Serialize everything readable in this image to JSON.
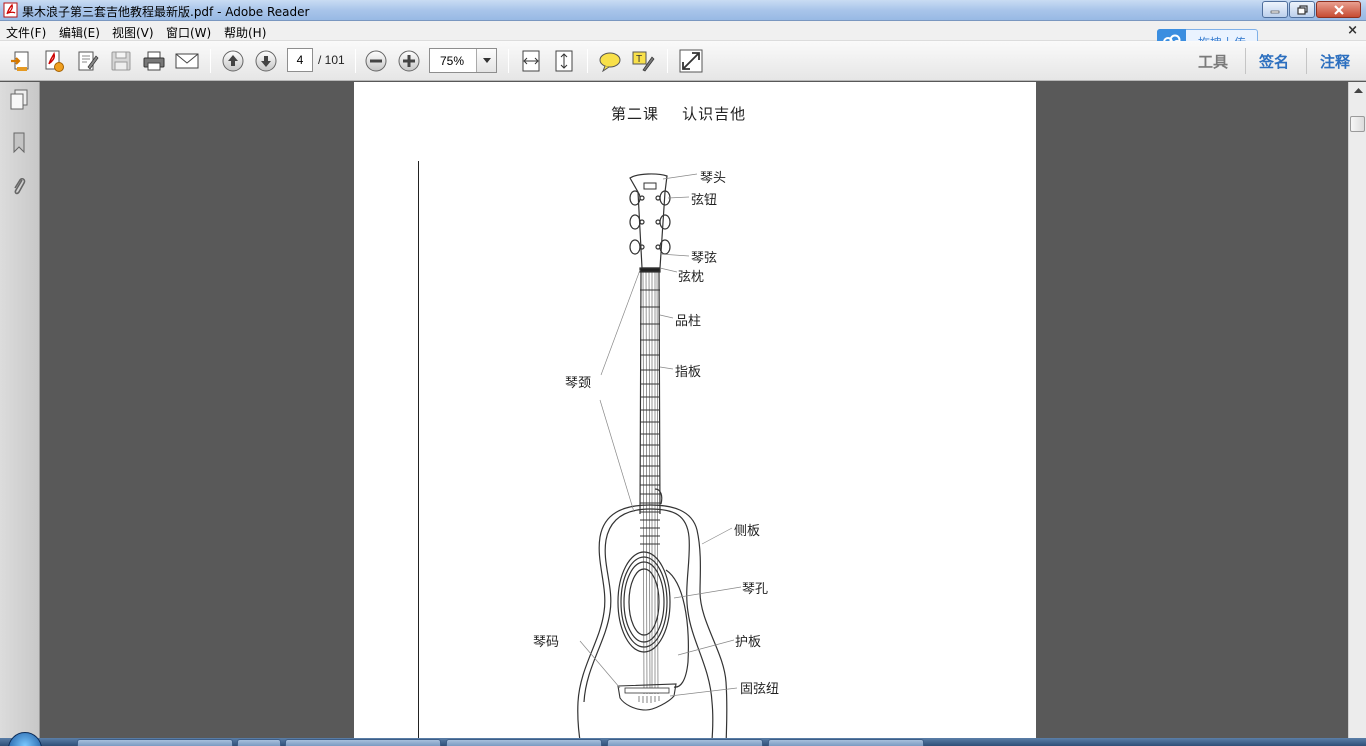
{
  "window": {
    "title": "果木浪子第三套吉他教程最新版.pdf - Adobe Reader"
  },
  "menu": {
    "items": [
      "文件(F)",
      "编辑(E)",
      "视图(V)",
      "窗口(W)",
      "帮助(H)"
    ]
  },
  "toolbar": {
    "page_current": "4",
    "page_total": "/ 101",
    "zoom": "75%",
    "right_links": [
      "工具",
      "签名",
      "注释"
    ]
  },
  "upload_bubble": {
    "label": "拖拽上传"
  },
  "document": {
    "lesson_title": "第二课    认识吉他",
    "labels": {
      "headstock": "琴头",
      "tuning_pegs": "弦钮",
      "strings": "琴弦",
      "nut": "弦枕",
      "frets": "品柱",
      "fingerboard": "指板",
      "neck": "琴颈",
      "side": "侧板",
      "soundhole": "琴孔",
      "pickguard": "护板",
      "bridge": "琴码",
      "bridge_pins": "固弦纽"
    }
  },
  "colors": {
    "accent": "#2c6fbf",
    "doc_background": "#595959",
    "page": "#ffffff"
  }
}
